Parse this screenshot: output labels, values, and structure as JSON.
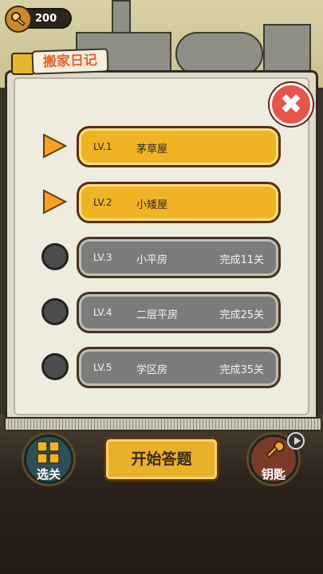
{
  "header": {
    "key_count": "200",
    "title": "搬家日记"
  },
  "levels": [
    {
      "lv": "LV.1",
      "name": "茅草屋",
      "requirement": "",
      "status": "unlocked"
    },
    {
      "lv": "LV.2",
      "name": "小矮屋",
      "requirement": "",
      "status": "unlocked"
    },
    {
      "lv": "LV.3",
      "name": "小平房",
      "requirement": "完成11关",
      "status": "locked"
    },
    {
      "lv": "LV.4",
      "name": "二层平房",
      "requirement": "完成25关",
      "status": "locked"
    },
    {
      "lv": "LV.5",
      "name": "学区房",
      "requirement": "完成35关",
      "status": "locked"
    }
  ],
  "bottom_bar": {
    "select_level_label": "选关",
    "start_label": "开始答题",
    "keys_label": "钥匙"
  },
  "colors": {
    "unlocked_bar": "#f0b323",
    "locked_bar": "#7c7c7a",
    "arrow": "#f2a321",
    "title": "#e1642b",
    "close": "#e7544a"
  },
  "icons": {
    "close": "close-icon",
    "key": "key-icon",
    "grid": "grid-icon",
    "play": "play-icon"
  }
}
